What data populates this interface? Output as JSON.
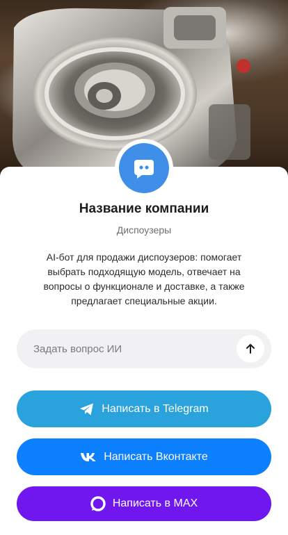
{
  "company": {
    "name": "Название компании",
    "category": "Диспоузеры",
    "description": "AI-бот для продажи диспоузеров: помогает выбрать подходящую модель, отвечает на вопросы о функционале и доставке, а также предлагает специальные акции.",
    "avatar_icon": "chat-bubble-icon",
    "avatar_color": "#3f8fe8"
  },
  "ai_chat": {
    "placeholder": "Задать вопрос ИИ",
    "value": "",
    "send_icon": "arrow-up-icon"
  },
  "actions": {
    "telegram": {
      "label": "Написать в Telegram",
      "icon": "telegram-icon",
      "color": "#2aa3dd"
    },
    "vk": {
      "label": "Написать Вконтакте",
      "icon": "vk-icon",
      "color": "#0d80ff"
    },
    "max": {
      "label": "Написать в MAX",
      "icon": "max-icon",
      "color": "#6f17ee"
    }
  }
}
